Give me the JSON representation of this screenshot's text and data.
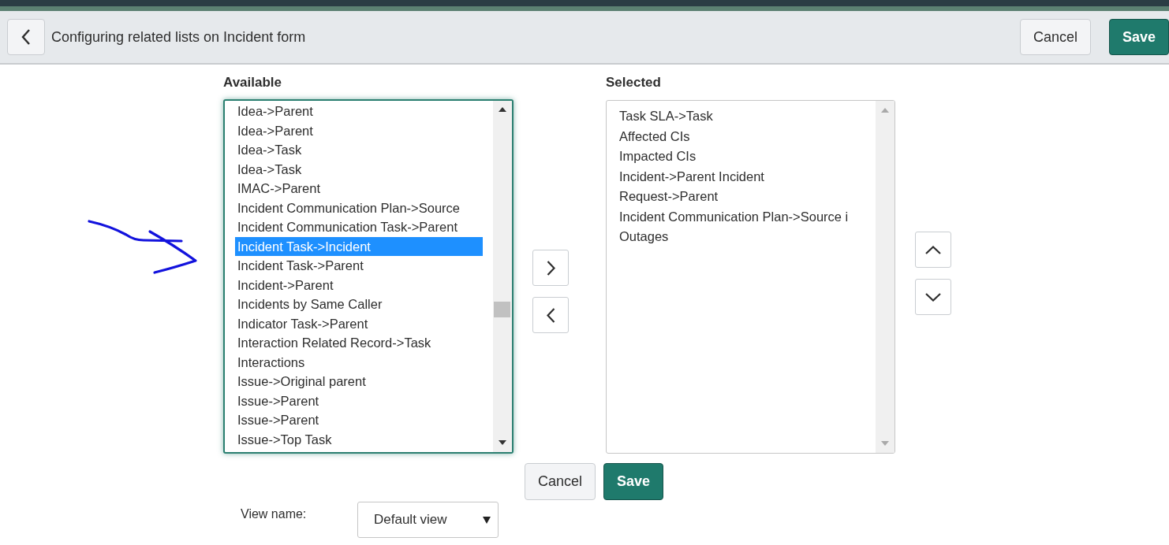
{
  "header": {
    "title": "Configuring related lists on Incident form",
    "buttons": [
      {
        "label": "Cancel",
        "kind": "secondary"
      },
      {
        "label": "Save",
        "kind": "primary"
      }
    ]
  },
  "available": {
    "label": "Available",
    "options": [
      {
        "label": "Idea->Parent",
        "selected": false
      },
      {
        "label": "Idea->Parent",
        "selected": false
      },
      {
        "label": "Idea->Task",
        "selected": false
      },
      {
        "label": "Idea->Task",
        "selected": false
      },
      {
        "label": "IMAC->Parent",
        "selected": false
      },
      {
        "label": "Incident Communication Plan->Source",
        "selected": false
      },
      {
        "label": "Incident Communication Task->Parent",
        "selected": false
      },
      {
        "label": "Incident Task->Incident",
        "selected": true
      },
      {
        "label": "Incident Task->Parent",
        "selected": false
      },
      {
        "label": "Incident->Parent",
        "selected": false
      },
      {
        "label": "Incidents by Same Caller",
        "selected": false
      },
      {
        "label": "Indicator Task->Parent",
        "selected": false
      },
      {
        "label": "Interaction Related Record->Task",
        "selected": false
      },
      {
        "label": "Interactions",
        "selected": false
      },
      {
        "label": "Issue->Original parent",
        "selected": false
      },
      {
        "label": "Issue->Parent",
        "selected": false
      },
      {
        "label": "Issue->Parent",
        "selected": false
      },
      {
        "label": "Issue->Top Task",
        "selected": false
      }
    ]
  },
  "selected_list": {
    "label": "Selected",
    "options": [
      {
        "label": "Task SLA->Task",
        "selected": false
      },
      {
        "label": "Affected CIs",
        "selected": false
      },
      {
        "label": "Impacted CIs",
        "selected": false
      },
      {
        "label": "Incident->Parent Incident",
        "selected": false
      },
      {
        "label": "Request->Parent",
        "selected": false
      },
      {
        "label": "Incident Communication Plan->Source i",
        "selected": false
      },
      {
        "label": "Outages",
        "selected": false
      }
    ]
  },
  "footer_buttons": [
    {
      "label": "Cancel",
      "kind": "secondary"
    },
    {
      "label": "Save",
      "kind": "primary"
    }
  ],
  "view_name": {
    "label": "View name:",
    "value": "Default view"
  }
}
